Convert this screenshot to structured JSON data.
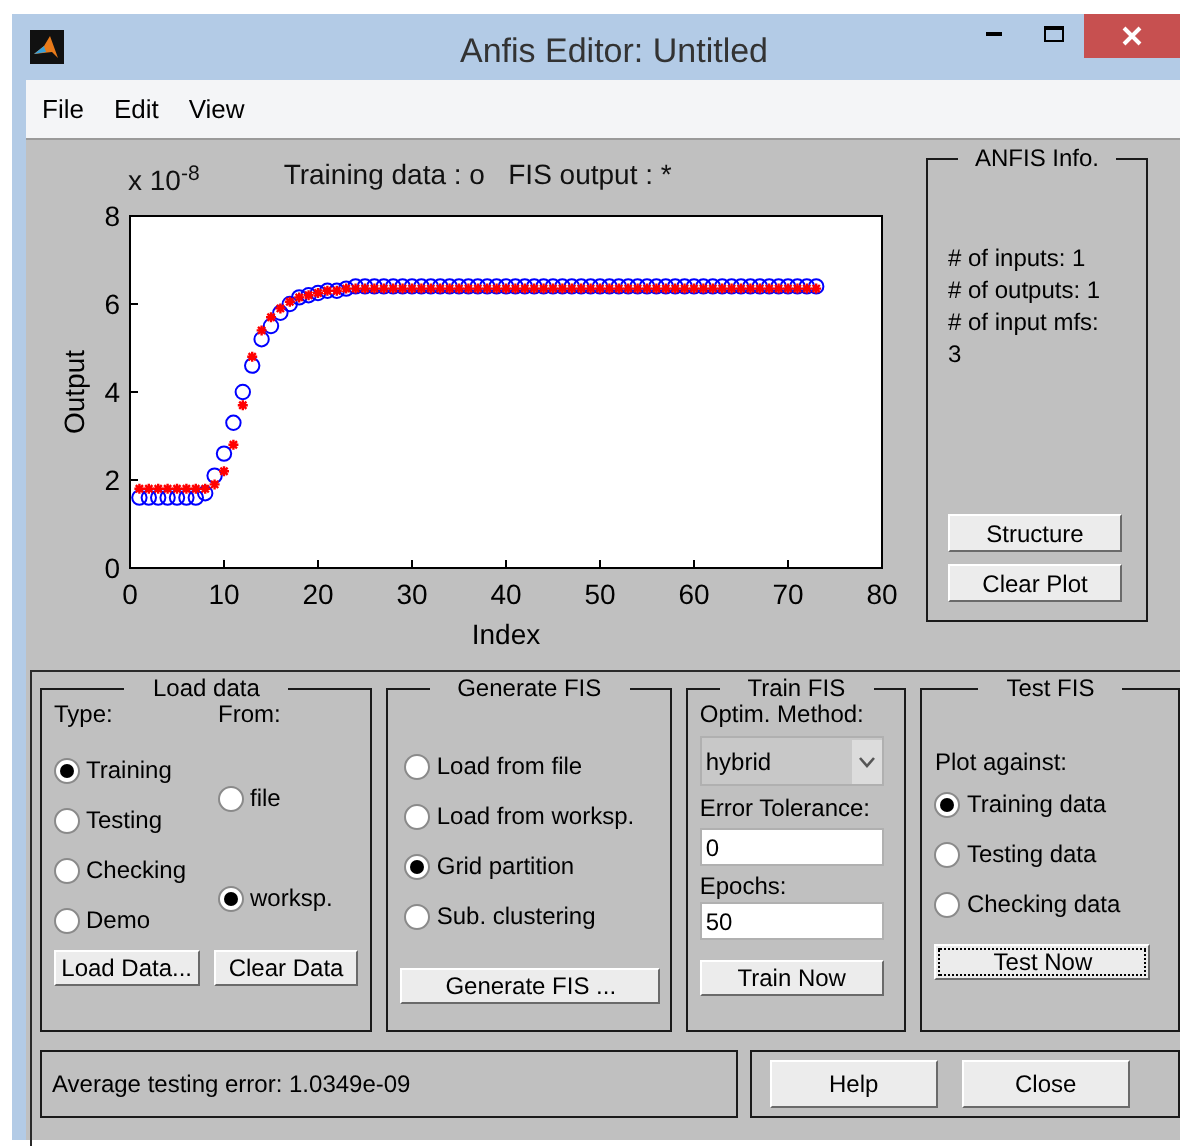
{
  "window": {
    "title": "Anfis Editor: Untitled"
  },
  "menu": [
    "File",
    "Edit",
    "View"
  ],
  "plot": {
    "scale_label": "x 10$^{-8}$",
    "chart_data": {
      "type": "scatter",
      "title": "Training data : o   FIS output : *",
      "xlabel": "Index",
      "ylabel": "Output",
      "xlim": [
        0,
        80
      ],
      "ylim": [
        0,
        8
      ],
      "xticks": [
        0,
        10,
        20,
        30,
        40,
        50,
        60,
        70,
        80
      ],
      "yticks": [
        0,
        2,
        4,
        6,
        8
      ],
      "x": [
        1,
        2,
        3,
        4,
        5,
        6,
        7,
        8,
        9,
        10,
        11,
        12,
        13,
        14,
        15,
        16,
        17,
        18,
        19,
        20,
        21,
        22,
        23,
        24,
        25,
        26,
        27,
        28,
        29,
        30,
        31,
        32,
        33,
        34,
        35,
        36,
        37,
        38,
        39,
        40,
        41,
        42,
        43,
        44,
        45,
        46,
        47,
        48,
        49,
        50,
        51,
        52,
        53,
        54,
        55,
        56,
        57,
        58,
        59,
        60,
        61,
        62,
        63,
        64,
        65,
        66,
        67,
        68,
        69,
        70,
        71,
        72,
        73
      ],
      "series": [
        {
          "color": "#0000ff",
          "values": [
            1.6,
            1.6,
            1.6,
            1.6,
            1.6,
            1.6,
            1.6,
            1.7,
            2.1,
            2.6,
            3.3,
            4.0,
            4.6,
            5.2,
            5.5,
            5.8,
            6.0,
            6.15,
            6.2,
            6.25,
            6.3,
            6.3,
            6.35,
            6.4,
            6.4,
            6.4,
            6.4,
            6.4,
            6.4,
            6.4,
            6.4,
            6.4,
            6.4,
            6.4,
            6.4,
            6.4,
            6.4,
            6.4,
            6.4,
            6.4,
            6.4,
            6.4,
            6.4,
            6.4,
            6.4,
            6.4,
            6.4,
            6.4,
            6.4,
            6.4,
            6.4,
            6.4,
            6.4,
            6.4,
            6.4,
            6.4,
            6.4,
            6.4,
            6.4,
            6.4,
            6.4,
            6.4,
            6.4,
            6.4,
            6.4,
            6.4,
            6.4,
            6.4,
            6.4,
            6.4,
            6.4,
            6.4,
            6.4
          ]
        },
        {
          "color": "#ff0000",
          "values": [
            1.8,
            1.8,
            1.8,
            1.8,
            1.8,
            1.8,
            1.8,
            1.8,
            1.9,
            2.2,
            2.8,
            3.7,
            4.8,
            5.4,
            5.7,
            5.9,
            6.05,
            6.15,
            6.2,
            6.25,
            6.3,
            6.3,
            6.35,
            6.35,
            6.35,
            6.35,
            6.35,
            6.35,
            6.35,
            6.35,
            6.35,
            6.35,
            6.35,
            6.35,
            6.35,
            6.35,
            6.35,
            6.35,
            6.35,
            6.35,
            6.35,
            6.35,
            6.35,
            6.35,
            6.35,
            6.35,
            6.35,
            6.35,
            6.35,
            6.35,
            6.35,
            6.35,
            6.35,
            6.35,
            6.35,
            6.35,
            6.35,
            6.35,
            6.35,
            6.35,
            6.35,
            6.35,
            6.35,
            6.35,
            6.35,
            6.35,
            6.35,
            6.35,
            6.35,
            6.35,
            6.35,
            6.35,
            6.35
          ]
        }
      ]
    }
  },
  "anfis_info": {
    "title": "ANFIS Info.",
    "lines": [
      "# of inputs: 1",
      "# of outputs: 1",
      "# of input mfs:",
      "3"
    ],
    "buttons": [
      "Structure",
      "Clear Plot"
    ]
  },
  "load_data": {
    "title": "Load data",
    "type_label": "Type:",
    "from_label": "From:",
    "types": [
      {
        "label": "Training",
        "selected": true
      },
      {
        "label": "Testing",
        "selected": false
      },
      {
        "label": "Checking",
        "selected": false
      },
      {
        "label": "Demo",
        "selected": false
      }
    ],
    "sources": [
      {
        "label": "file",
        "selected": false
      },
      {
        "label": "worksp.",
        "selected": true
      }
    ],
    "buttons": [
      "Load Data...",
      "Clear Data"
    ]
  },
  "generate_fis": {
    "title": "Generate FIS",
    "options": [
      {
        "label": "Load from file",
        "selected": false
      },
      {
        "label": "Load from worksp.",
        "selected": false
      },
      {
        "label": "Grid partition",
        "selected": true
      },
      {
        "label": "Sub. clustering",
        "selected": false
      }
    ],
    "button": "Generate FIS ..."
  },
  "train_fis": {
    "title": "Train FIS",
    "method_label": "Optim. Method:",
    "method": "hybrid",
    "tolerance_label": "Error Tolerance:",
    "tolerance": "0",
    "epochs_label": "Epochs:",
    "epochs": "50",
    "button": "Train Now"
  },
  "test_fis": {
    "title": "Test FIS",
    "plot_label": "Plot against:",
    "options": [
      {
        "label": "Training data",
        "selected": true
      },
      {
        "label": "Testing data",
        "selected": false
      },
      {
        "label": "Checking data",
        "selected": false
      }
    ],
    "button": "Test Now"
  },
  "status": "Average testing error: 1.0349e-09",
  "buttons": [
    "Help",
    "Close"
  ]
}
